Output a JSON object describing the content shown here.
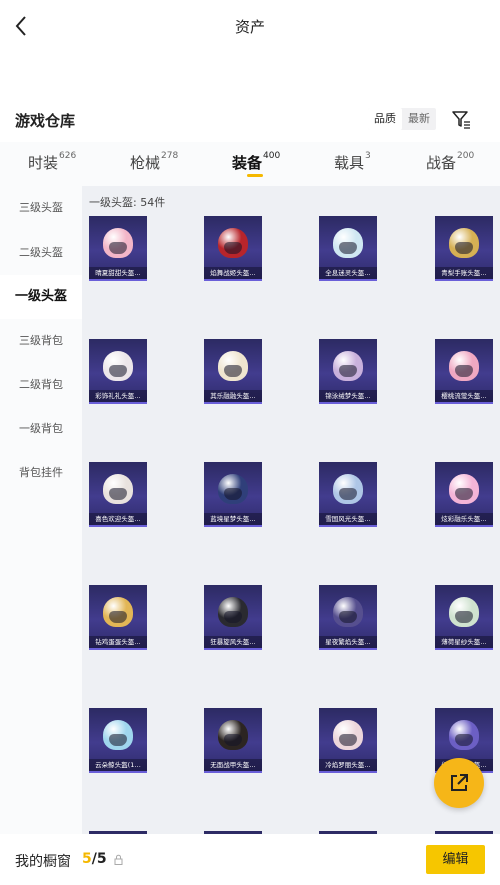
{
  "header": {
    "title": "资产",
    "back_label": "back"
  },
  "warehouse": {
    "title": "游戏仓库",
    "sort_options": [
      "品质",
      "最新"
    ],
    "active_sort": "品质"
  },
  "tabs": [
    {
      "label": "时装",
      "count": "626"
    },
    {
      "label": "枪械",
      "count": "278"
    },
    {
      "label": "装备",
      "count": "400",
      "active": true
    },
    {
      "label": "载具",
      "count": "3"
    },
    {
      "label": "战备",
      "count": "200"
    }
  ],
  "sidebar": {
    "items": [
      "三级头盔",
      "二级头盔",
      "一级头盔",
      "三级背包",
      "二级背包",
      "一级背包",
      "背包挂件"
    ],
    "active": "一级头盔"
  },
  "grid": {
    "count_label": "一级头盔: 54件",
    "items": [
      {
        "name": "晴夏甜甜头盔…",
        "color": "#f3b6c8"
      },
      {
        "name": "焰舞战姬头盔…",
        "color": "#b8252b"
      },
      {
        "name": "全息迷灵头盔…",
        "color": "#cfe7f2"
      },
      {
        "name": "青梨手账头盔…",
        "color": "#d6b054"
      },
      {
        "name": "彩饰礼礼头盔…",
        "color": "#ece6ea"
      },
      {
        "name": "其乐融融头盔…",
        "color": "#efe5cf"
      },
      {
        "name": "锦泳绒梦头盔…",
        "color": "#c9b1dc"
      },
      {
        "name": "樱桃流萤头盔…",
        "color": "#f0a8c2"
      },
      {
        "name": "喜色欢迎头盔…",
        "color": "#e9e2de"
      },
      {
        "name": "蓝境星梦头盔…",
        "color": "#2f3f7a"
      },
      {
        "name": "雪国风光头盔…",
        "color": "#aec6e6"
      },
      {
        "name": "炫彩融乐头盔…",
        "color": "#f4b4d7"
      },
      {
        "name": "钻鸡蛋蛋头盔…",
        "color": "#e2b656"
      },
      {
        "name": "狂暴旋风头盔…",
        "color": "#2a2a30"
      },
      {
        "name": "星夜繁焰头盔…",
        "color": "#564f8f"
      },
      {
        "name": "薄荷星纱头盔…",
        "color": "#cfe2cf"
      },
      {
        "name": "云朵鲸头盔(1…",
        "color": "#9fd6ee"
      },
      {
        "name": "无面战甲头盔…",
        "color": "#2c2522"
      },
      {
        "name": "冷焰罗丽头盔…",
        "color": "#ecd6db"
      },
      {
        "name": "幻境星灵头盔…",
        "color": "#6c5fc4"
      },
      {
        "name": "",
        "color": "#3a3a80"
      },
      {
        "name": "",
        "color": "#3a3a80"
      },
      {
        "name": "",
        "color": "#3a3a80"
      },
      {
        "name": "",
        "color": "#3a3a80"
      }
    ]
  },
  "fab": {
    "icon": "share-icon"
  },
  "bottom": {
    "showcase_label": "我的橱窗",
    "showcase_current": "5",
    "showcase_total": "/5",
    "edit_label": "编辑"
  },
  "colors": {
    "accent": "#f5b800",
    "tile_bg": "#3a3580",
    "edit_button": "#f6c600"
  }
}
